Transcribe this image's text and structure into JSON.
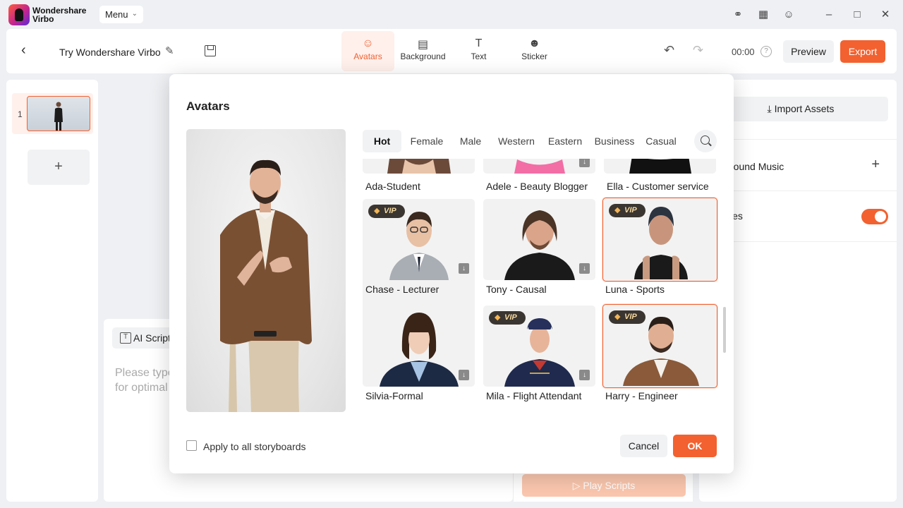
{
  "app": {
    "brand_line1": "Wondershare",
    "brand_line2": "Virbo",
    "menu_label": "Menu"
  },
  "toolbar": {
    "project_title": "Try Wondershare Virbo",
    "tabs": [
      {
        "label": "Avatars",
        "icon": "avatar-icon",
        "active": true
      },
      {
        "label": "Background",
        "icon": "background-icon",
        "active": false
      },
      {
        "label": "Text",
        "icon": "text-icon",
        "active": false
      },
      {
        "label": "Sticker",
        "icon": "sticker-icon",
        "active": false
      }
    ],
    "time": "00:00",
    "preview_label": "Preview",
    "export_label": "Export"
  },
  "storyboard": {
    "items": [
      {
        "number": "1"
      }
    ],
    "add_label": "+"
  },
  "script": {
    "ai_script_label": "AI Script",
    "placeholder_line1": "Please type",
    "placeholder_line2": "for optimal",
    "play_label": "Play Scripts"
  },
  "right_panel": {
    "import_label": "Import Assets",
    "music_label": "round Music",
    "subtitles_label": "les",
    "subtitles_on": true
  },
  "modal": {
    "title": "Avatars",
    "categories": [
      "Hot",
      "Female",
      "Male",
      "Western",
      "Eastern",
      "Business",
      "Casual"
    ],
    "active_category": "Hot",
    "avatars": [
      {
        "name": "Ada-Student",
        "vip": false,
        "download": false,
        "selected": false
      },
      {
        "name": "Adele - Beauty Blogger",
        "vip": false,
        "download": true,
        "selected": false
      },
      {
        "name": "Ella - Customer service",
        "vip": false,
        "download": false,
        "selected": false
      },
      {
        "name": "Chase - Lecturer",
        "vip": true,
        "download": true,
        "selected": false
      },
      {
        "name": "Tony - Causal",
        "vip": false,
        "download": true,
        "selected": false
      },
      {
        "name": "Luna - Sports",
        "vip": true,
        "download": false,
        "selected": true
      },
      {
        "name": "Silvia-Formal",
        "vip": false,
        "download": true,
        "selected": false
      },
      {
        "name": "Mila - Flight Attendant",
        "vip": true,
        "download": true,
        "selected": false
      },
      {
        "name": "Harry - Engineer",
        "vip": true,
        "download": false,
        "selected": true
      }
    ],
    "vip_label": "VIP",
    "apply_all_label": "Apply to all storyboards",
    "cancel_label": "Cancel",
    "ok_label": "OK"
  },
  "colors": {
    "accent": "#f2612f",
    "accent_light": "#fff0ec"
  }
}
